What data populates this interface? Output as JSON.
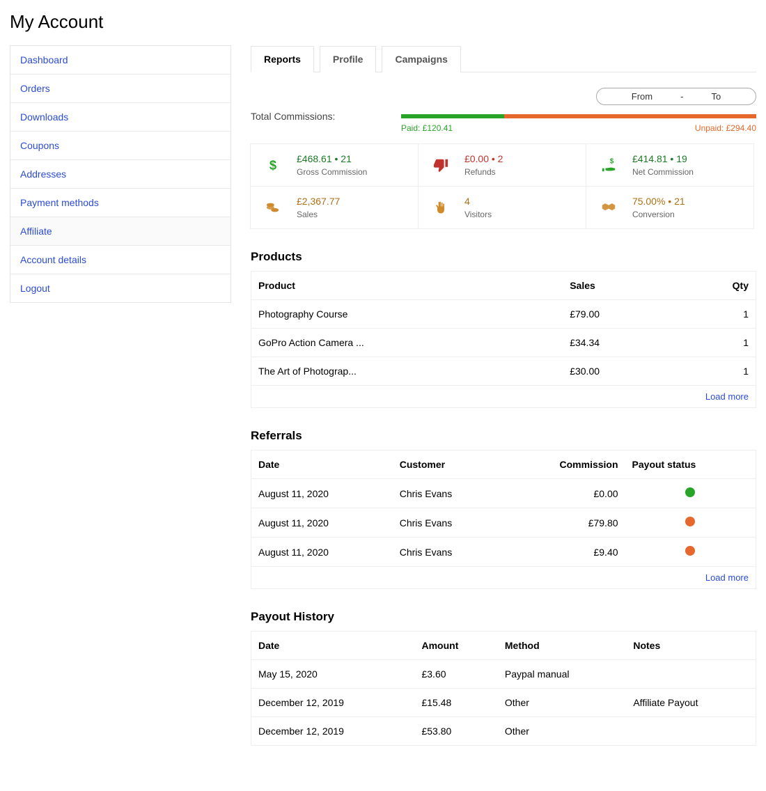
{
  "page_title": "My Account",
  "sidebar": {
    "items": [
      {
        "label": "Dashboard"
      },
      {
        "label": "Orders"
      },
      {
        "label": "Downloads"
      },
      {
        "label": "Coupons"
      },
      {
        "label": "Addresses"
      },
      {
        "label": "Payment methods"
      },
      {
        "label": "Affiliate"
      },
      {
        "label": "Account details"
      },
      {
        "label": "Logout"
      }
    ]
  },
  "tabs": {
    "items": [
      {
        "label": "Reports"
      },
      {
        "label": "Profile"
      },
      {
        "label": "Campaigns"
      }
    ]
  },
  "daterange": {
    "from": "From",
    "sep": "-",
    "to": "To"
  },
  "commissions": {
    "label": "Total Commissions:",
    "paid_label": "Paid: £120.41",
    "unpaid_label": "Unpaid: £294.40",
    "paid_value": 120.41,
    "unpaid_value": 294.4
  },
  "stats": [
    {
      "value": "£468.61 • 21",
      "label": "Gross Commission",
      "color": "green",
      "icon": "dollar"
    },
    {
      "value": "£0.00 • 2",
      "label": "Refunds",
      "color": "red",
      "icon": "thumbdown"
    },
    {
      "value": "£414.81 • 19",
      "label": "Net Commission",
      "color": "green",
      "icon": "handdollar"
    },
    {
      "value": "£2,367.77",
      "label": "Sales",
      "color": "orange",
      "icon": "coins"
    },
    {
      "value": "4",
      "label": "Visitors",
      "color": "orange",
      "icon": "hand"
    },
    {
      "value": "75.00% • 21",
      "label": "Conversion",
      "color": "orange",
      "icon": "handshake"
    }
  ],
  "products": {
    "title": "Products",
    "headers": {
      "product": "Product",
      "sales": "Sales",
      "qty": "Qty"
    },
    "rows": [
      {
        "product": "Photography Course",
        "sales": "£79.00",
        "qty": "1"
      },
      {
        "product": "GoPro Action Camera ...",
        "sales": "£34.34",
        "qty": "1"
      },
      {
        "product": "The Art of Photograp...",
        "sales": "£30.00",
        "qty": "1"
      }
    ],
    "load_more": "Load more"
  },
  "referrals": {
    "title": "Referrals",
    "headers": {
      "date": "Date",
      "customer": "Customer",
      "commission": "Commission",
      "status": "Payout status"
    },
    "rows": [
      {
        "date": "August 11, 2020",
        "customer": "Chris Evans",
        "commission": "£0.00",
        "status": "green"
      },
      {
        "date": "August 11, 2020",
        "customer": "Chris Evans",
        "commission": "£79.80",
        "status": "orange"
      },
      {
        "date": "August 11, 2020",
        "customer": "Chris Evans",
        "commission": "£9.40",
        "status": "orange"
      }
    ],
    "load_more": "Load more"
  },
  "payout": {
    "title": "Payout History",
    "headers": {
      "date": "Date",
      "amount": "Amount",
      "method": "Method",
      "notes": "Notes"
    },
    "rows": [
      {
        "date": "May 15, 2020",
        "amount": "£3.60",
        "method": "Paypal manual",
        "notes": ""
      },
      {
        "date": "December 12, 2019",
        "amount": "£15.48",
        "method": "Other",
        "notes": "Affiliate Payout"
      },
      {
        "date": "December 12, 2019",
        "amount": "£53.80",
        "method": "Other",
        "notes": ""
      }
    ]
  },
  "chart_data": {
    "type": "bar",
    "title": "Total Commissions",
    "categories": [
      "Paid",
      "Unpaid"
    ],
    "values": [
      120.41,
      294.4
    ],
    "currency": "GBP",
    "colors": {
      "Paid": "#28a428",
      "Unpaid": "#e6682c"
    }
  }
}
